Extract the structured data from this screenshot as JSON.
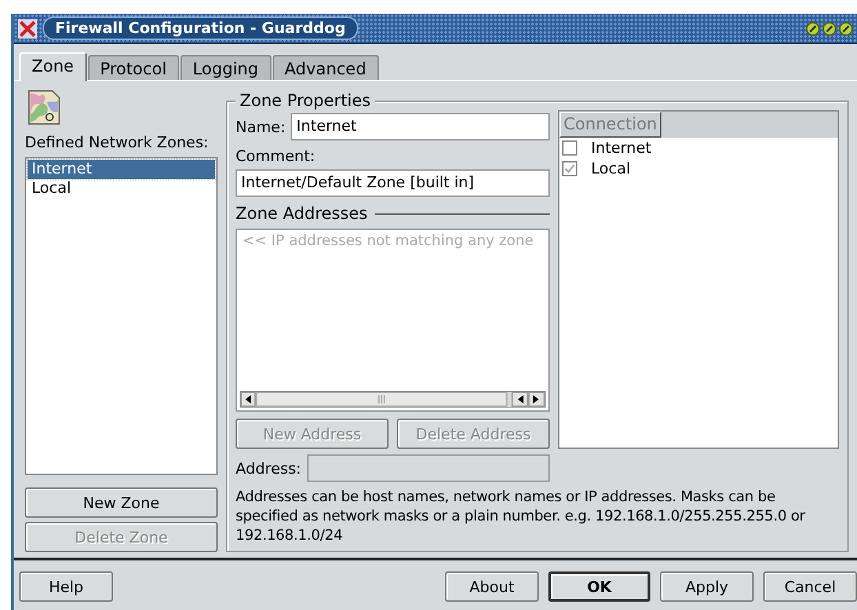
{
  "window": {
    "title": "Firewall Configuration - Guarddog"
  },
  "tabs": [
    {
      "label": "Zone",
      "selected": true
    },
    {
      "label": "Protocol",
      "selected": false
    },
    {
      "label": "Logging",
      "selected": false
    },
    {
      "label": "Advanced",
      "selected": false
    }
  ],
  "zones": {
    "label": "Defined Network Zones:",
    "items": [
      {
        "label": "Internet",
        "selected": true
      },
      {
        "label": "Local",
        "selected": false
      }
    ],
    "buttons": [
      {
        "label": "New Zone",
        "disabled": false
      },
      {
        "label": "Delete Zone",
        "disabled": true
      }
    ]
  },
  "zone_properties": {
    "title": "Zone Properties",
    "name_label": "Name:",
    "name_value": "Internet",
    "comment_label": "Comment:",
    "comment_value": "Internet/Default Zone [built in]",
    "addresses_title": "Zone Addresses",
    "addresses_placeholder": "<< IP addresses not matching any zone",
    "address_buttons": [
      {
        "label": "New Address",
        "disabled": true
      },
      {
        "label": "Delete Address",
        "disabled": true
      }
    ],
    "address_label": "Address:",
    "connection_header": "Connection",
    "connections": [
      {
        "label": "Internet",
        "checked": false
      },
      {
        "label": "Local",
        "checked": true
      }
    ],
    "hint": "Addresses can be host names, network names or IP addresses. Masks can be specified as network masks or a plain number. e.g. 192.168.1.0/255.255.255.0 or 192.168.1.0/24"
  },
  "buttons": [
    {
      "label": "Help",
      "default": false
    },
    {
      "label": "About",
      "default": false
    },
    {
      "label": "OK",
      "default": true
    },
    {
      "label": "Apply",
      "default": false
    },
    {
      "label": "Cancel",
      "default": false
    }
  ]
}
